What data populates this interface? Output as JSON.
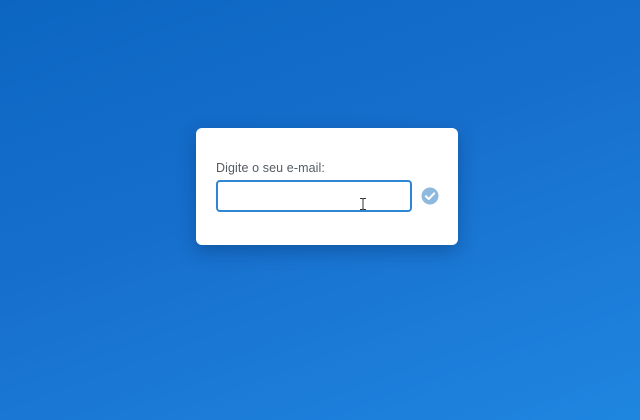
{
  "form": {
    "label": "Digite o seu e-mail:",
    "email_value": "",
    "email_placeholder": "",
    "submit_icon": "check-circle-icon"
  },
  "colors": {
    "background_start": "#0b66c2",
    "background_end": "#1f86e0",
    "card": "#ffffff",
    "input_border": "#2f86d4",
    "check_fill": "#8fb8df",
    "label_text": "#555b63"
  }
}
